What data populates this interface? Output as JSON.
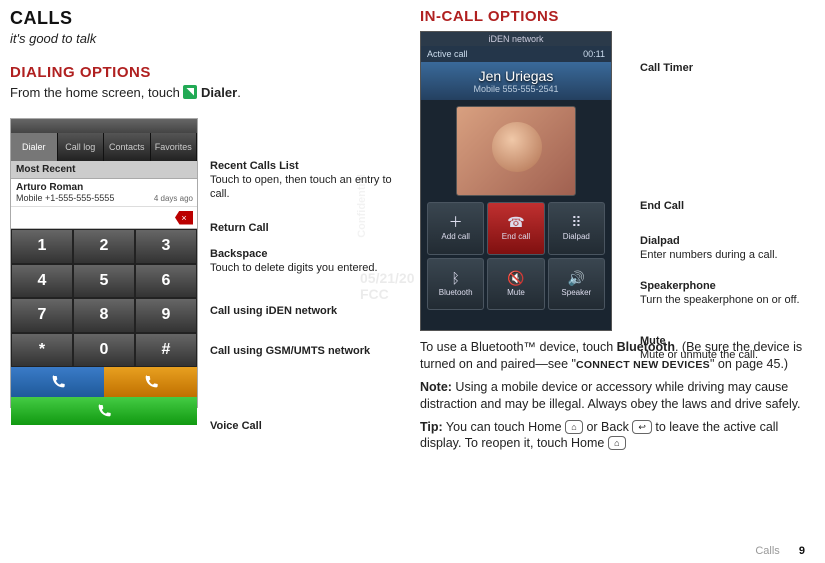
{
  "left": {
    "title": "Calls",
    "tagline": "it's good to talk",
    "dialing_heading": "Dialing options",
    "dialing_intro_1": "From the home screen, touch ",
    "dialing_intro_2": " Dialer",
    "dialing_intro_3": ".",
    "tabs": [
      "Dialer",
      "Call log",
      "Contacts",
      "Favorites"
    ],
    "most_recent_label": "Most Recent",
    "recent": {
      "name": "Arturo Roman",
      "number": "Mobile +1-555-555-5555",
      "ago": "4 days ago"
    },
    "keys": [
      "1",
      "2",
      "3",
      "4",
      "5",
      "6",
      "7",
      "8",
      "9",
      "*",
      "0",
      "#"
    ],
    "callouts": {
      "recent_list_title": "Recent Calls List",
      "recent_list_desc": "Touch to open, then touch an entry to call.",
      "return_call": "Return Call",
      "backspace_title": "Backspace",
      "backspace_desc": "Touch to delete digits you entered.",
      "iden": "Call using iDEN network",
      "gsm": "Call using GSM/UMTS network",
      "voice": "Voice Call"
    }
  },
  "right": {
    "title": "In-call options",
    "screen": {
      "network": "iDEN network",
      "status": "Active call",
      "timer": "00:11",
      "name": "Jen Uriegas",
      "number": "Mobile 555-555-2541",
      "actions": {
        "add": "Add call",
        "end": "End call",
        "dialpad": "Dialpad",
        "bluetooth": "Bluetooth",
        "mute": "Mute",
        "speaker": "Speaker"
      }
    },
    "callouts": {
      "timer": "Call Timer",
      "end": "End Call",
      "dialpad_title": "Dialpad",
      "dialpad_desc": "Enter numbers during a call.",
      "speaker_title": "Speakerphone",
      "speaker_desc": "Turn the speakerphone on or off.",
      "mute_title": "Mute",
      "mute_desc": "Mute or unmute the call."
    },
    "body": {
      "p1a": "To use a Bluetooth™ device, touch ",
      "p1b": "Bluetooth",
      "p1c": ". (Be sure the device is turned on and paired—see \"",
      "p1d": "Connect new devices",
      "p1e": "\" on page 45.)",
      "note_label": "Note:",
      "note_text": " Using a mobile device or accessory while driving may cause distraction and may be illegal. Always obey the laws and drive safely.",
      "tip_label": "Tip:",
      "tip_1": " You can touch Home ",
      "tip_2": " or Back ",
      "tip_3": " to leave the active call display. To reopen it, touch Home "
    }
  },
  "watermark": {
    "date": "05/21/20",
    "fcc": "FCC",
    "conf": "Confidential"
  },
  "footer": {
    "section": "Calls",
    "page": "9"
  }
}
